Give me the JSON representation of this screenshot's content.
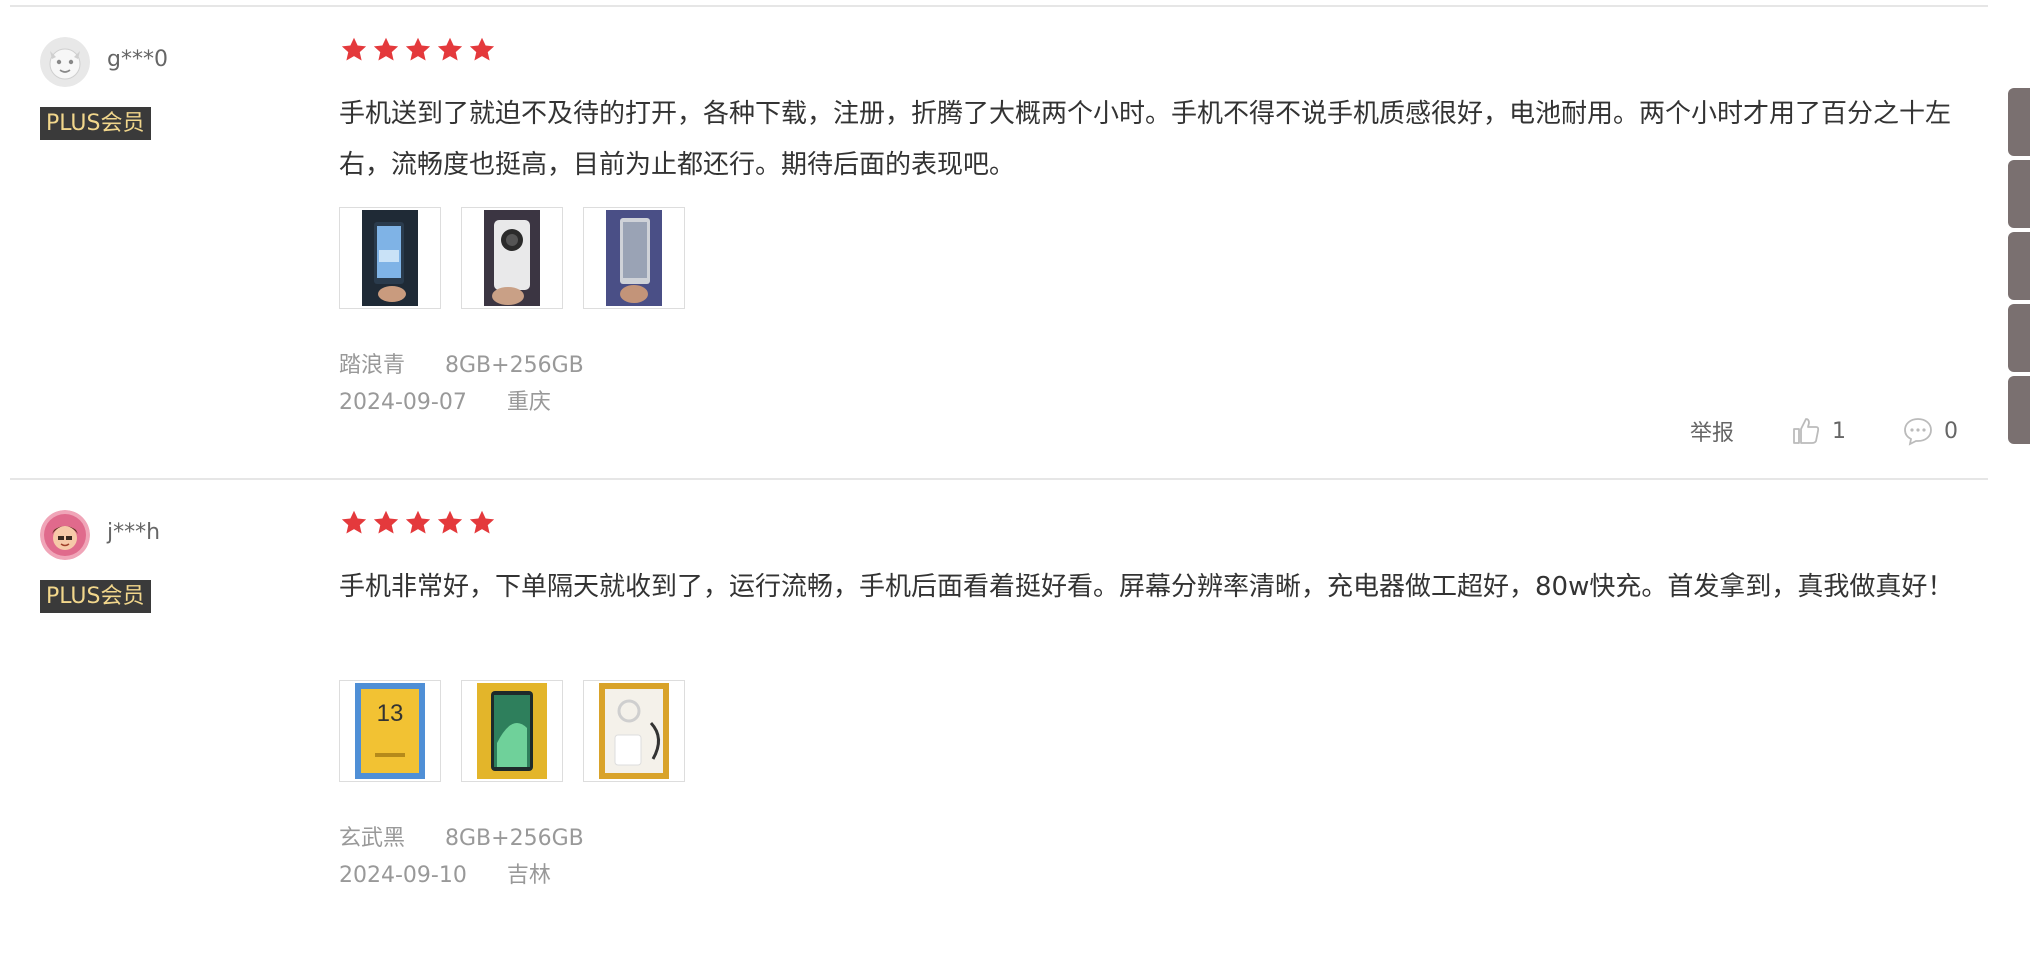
{
  "colors": {
    "star": "#e4393c",
    "badge_bg": "#3a3a3a",
    "badge_text": "#f2d78c",
    "meta_text": "#999999",
    "side_tab": "#7a7070"
  },
  "reviews": [
    {
      "username": "g***0",
      "badge": "PLUS会员",
      "rating": 5,
      "text": "手机送到了就迫不及待的打开，各种下载，注册，折腾了大概两个小时。手机不得不说手机质感很好，电池耐用。两个小时才用了百分之十左右，流畅度也挺高，目前为止都还行。期待后面的表现吧。",
      "color_variant": "踏浪青",
      "storage": "8GB+256GB",
      "date": "2024-09-07",
      "location": "重庆",
      "report_label": "举报",
      "likes": "1",
      "comments": "0"
    },
    {
      "username": "j***h",
      "badge": "PLUS会员",
      "rating": 5,
      "text": "手机非常好，下单隔天就收到了，运行流畅，手机后面看着挺好看。屏幕分辨率清晰，充电器做工超好，80w快充。首发拿到，真我做真好！",
      "color_variant": "玄武黑",
      "storage": "8GB+256GB",
      "date": "2024-09-10",
      "location": "吉林",
      "photo_box_text": "13"
    }
  ]
}
